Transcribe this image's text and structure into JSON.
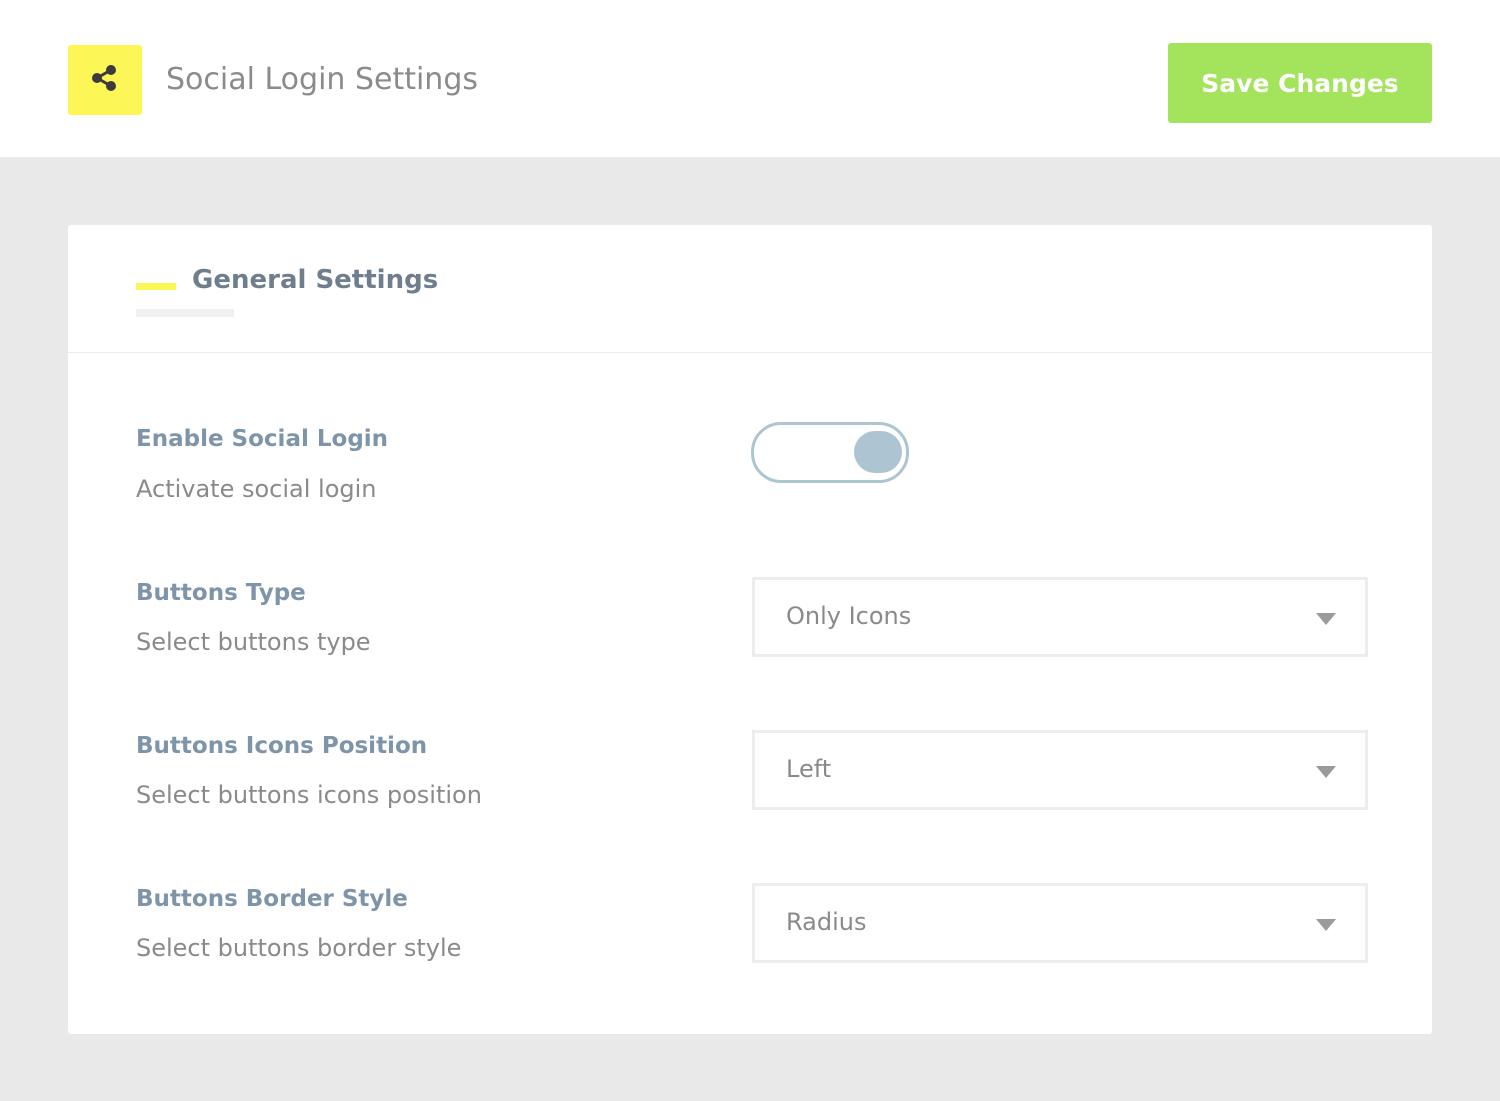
{
  "header": {
    "title": "Social Login Settings",
    "icon": "share-icon",
    "icon_bg": "#fcf657",
    "save_label": "Save Changes",
    "save_color": "#a4e45c"
  },
  "section": {
    "title": "General Settings",
    "accent_color": "#fcf657"
  },
  "settings": [
    {
      "label": "Enable Social Login",
      "description": "Activate social login",
      "control": "toggle",
      "value": "on"
    },
    {
      "label": "Buttons Type",
      "description": "Select buttons type",
      "control": "select",
      "value": "Only Icons"
    },
    {
      "label": "Buttons Icons Position",
      "description": "Select buttons icons position",
      "control": "select",
      "value": "Left"
    },
    {
      "label": "Buttons Border Style",
      "description": "Select buttons border style",
      "control": "select",
      "value": "Radius"
    }
  ]
}
